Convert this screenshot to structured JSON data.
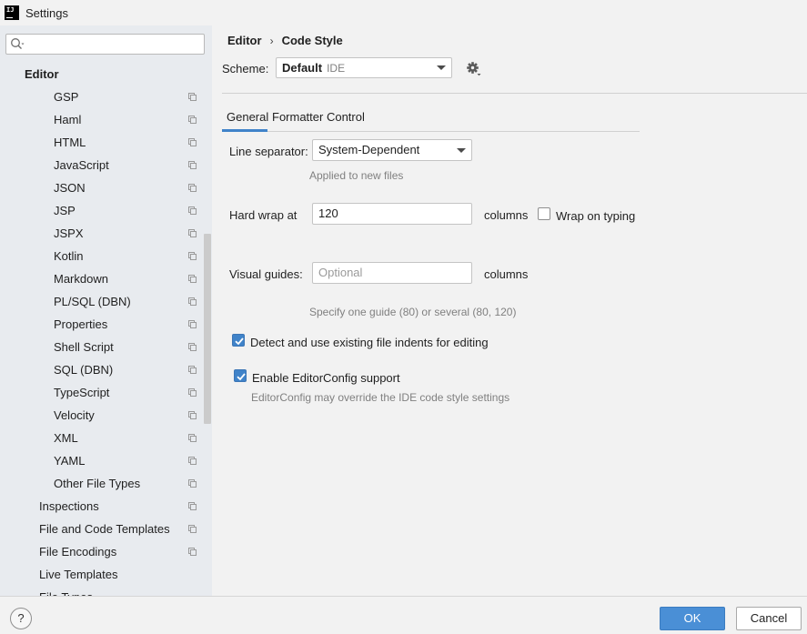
{
  "window": {
    "title": "Settings",
    "logo_text": "IJ"
  },
  "sidebar": {
    "search": {
      "value": "",
      "placeholder": ""
    },
    "items": [
      {
        "label": "Editor",
        "level": 0,
        "copy_icon": false
      },
      {
        "label": "GSP",
        "level": 2,
        "copy_icon": true
      },
      {
        "label": "Haml",
        "level": 2,
        "copy_icon": true
      },
      {
        "label": "HTML",
        "level": 2,
        "copy_icon": true
      },
      {
        "label": "JavaScript",
        "level": 2,
        "copy_icon": true
      },
      {
        "label": "JSON",
        "level": 2,
        "copy_icon": true
      },
      {
        "label": "JSP",
        "level": 2,
        "copy_icon": true
      },
      {
        "label": "JSPX",
        "level": 2,
        "copy_icon": true
      },
      {
        "label": "Kotlin",
        "level": 2,
        "copy_icon": true
      },
      {
        "label": "Markdown",
        "level": 2,
        "copy_icon": true
      },
      {
        "label": "PL/SQL (DBN)",
        "level": 2,
        "copy_icon": true
      },
      {
        "label": "Properties",
        "level": 2,
        "copy_icon": true
      },
      {
        "label": "Shell Script",
        "level": 2,
        "copy_icon": true
      },
      {
        "label": "SQL (DBN)",
        "level": 2,
        "copy_icon": true
      },
      {
        "label": "TypeScript",
        "level": 2,
        "copy_icon": true
      },
      {
        "label": "Velocity",
        "level": 2,
        "copy_icon": true
      },
      {
        "label": "XML",
        "level": 2,
        "copy_icon": true
      },
      {
        "label": "YAML",
        "level": 2,
        "copy_icon": true
      },
      {
        "label": "Other File Types",
        "level": 2,
        "copy_icon": true
      },
      {
        "label": "Inspections",
        "level": 1,
        "copy_icon": true
      },
      {
        "label": "File and Code Templates",
        "level": 1,
        "copy_icon": true
      },
      {
        "label": "File Encodings",
        "level": 1,
        "copy_icon": true
      },
      {
        "label": "Live Templates",
        "level": 1,
        "copy_icon": false
      },
      {
        "label": "File Types",
        "level": 1,
        "copy_icon": false
      }
    ]
  },
  "header": {
    "breadcrumb": [
      "Editor",
      "Code Style"
    ],
    "breadcrumb_separator": "›",
    "scheme_label": "Scheme:",
    "scheme_name": "Default",
    "scheme_scope": "IDE"
  },
  "tabs": [
    {
      "label": "General",
      "active": true
    },
    {
      "label": "Formatter Control",
      "active": false
    }
  ],
  "general": {
    "line_separator_label": "Line separator:",
    "line_separator_value": "System-Dependent",
    "line_separator_hint": "Applied to new files",
    "hard_wrap_label": "Hard wrap at",
    "hard_wrap_value": "120",
    "hard_wrap_unit": "columns",
    "wrap_on_typing_label": "Wrap on typing",
    "wrap_on_typing_checked": false,
    "visual_guides_label": "Visual guides:",
    "visual_guides_value": "",
    "visual_guides_placeholder": "Optional",
    "visual_guides_unit": "columns",
    "visual_guides_hint": "Specify one guide (80) or several (80, 120)",
    "detect_indents_label": "Detect and use existing file indents for editing",
    "detect_indents_checked": true,
    "editorconfig_label": "Enable EditorConfig support",
    "editorconfig_checked": true,
    "editorconfig_hint": "EditorConfig may override the IDE code style settings"
  },
  "footer": {
    "help_label": "?",
    "ok_label": "OK",
    "cancel_label": "Cancel"
  },
  "colors": {
    "accent": "#4083c9",
    "ok_button": "#4a8fd6",
    "sidebar_bg": "#e8ebef",
    "panel_bg": "#f2f2f2"
  }
}
